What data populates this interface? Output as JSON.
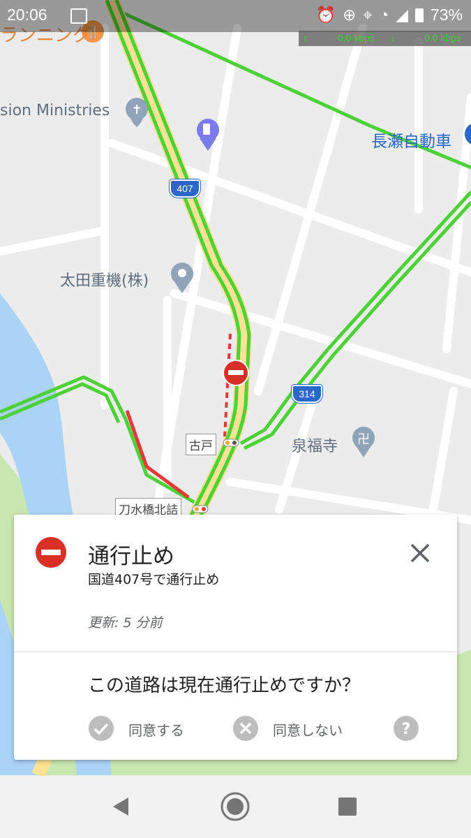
{
  "status_bar": {
    "time": "20:06",
    "battery": "73%",
    "upload_speed": "0.0 kbps",
    "download_speed": "0.0 kbps"
  },
  "map": {
    "labels": {
      "restaurant": "ランニング",
      "church": "sion Ministries",
      "dealer": "長瀬自動車",
      "company": "太田重機(株)",
      "temple": "泉福寺",
      "stop_kodo": "古戸",
      "stop_bridge": "刀水橋北詰"
    },
    "route_shields": {
      "r407": "407",
      "r314": "314"
    },
    "colors": {
      "traffic_green": "#4cd137",
      "traffic_red": "#e53935",
      "highway_fill": "#fde293",
      "river": "#aad3f6",
      "park": "#c8e6b0",
      "closure": "#d93025"
    }
  },
  "card": {
    "title": "通行止め",
    "subtitle": "国道407号で通行止め",
    "updated": "更新: 5 分前",
    "question": "この道路は現在通行止めですか？",
    "agree_label": "同意する",
    "disagree_label": "同意しない",
    "icons": {
      "closure": "no-entry-icon",
      "close": "close-icon",
      "agree": "check-circle-icon",
      "disagree": "x-circle-icon",
      "help": "help-circle-icon"
    }
  },
  "nav_bar": {
    "icons": [
      "back-icon",
      "home-icon",
      "recents-icon"
    ]
  }
}
